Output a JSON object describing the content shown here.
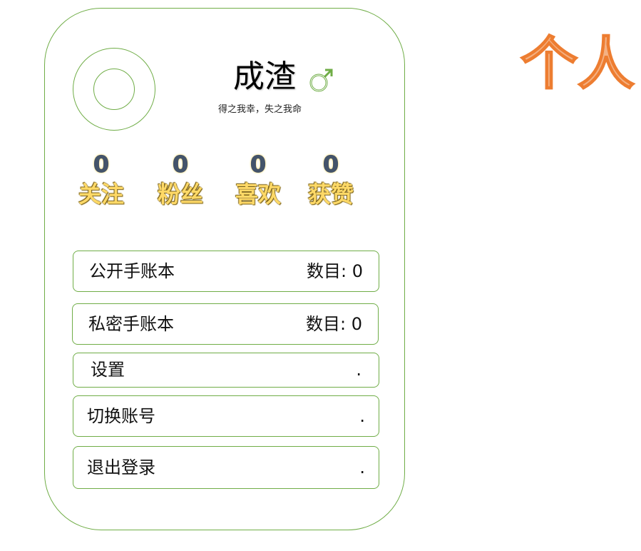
{
  "profile": {
    "username": "成渣",
    "gender_symbol": "♂",
    "motto": "得之我幸，失之我命"
  },
  "stats": [
    {
      "count": "0",
      "label": "关注"
    },
    {
      "count": "0",
      "label": "粉丝"
    },
    {
      "count": "0",
      "label": "喜欢"
    },
    {
      "count": "0",
      "label": "获赞"
    }
  ],
  "menu": [
    {
      "label": "公开手账本",
      "value": "数目:  0"
    },
    {
      "label": "私密手账本",
      "value": "数目:  0"
    },
    {
      "label": "设置",
      "value": "."
    },
    {
      "label": "切换账号",
      "value": "."
    },
    {
      "label": "退出登录",
      "value": "."
    }
  ],
  "page_title": "个人",
  "colors": {
    "border_green": "#70ad47",
    "stat_yellow": "#ffd966",
    "title_orange": "#f4b183"
  }
}
